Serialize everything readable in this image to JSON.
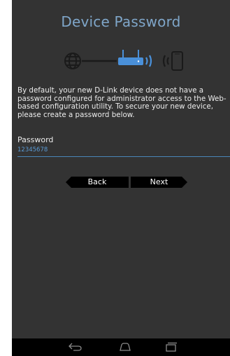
{
  "page": {
    "title": "Device Password",
    "description": "By default, your new D-Link device does not have a password configured for administrator access to the Web-based configuration utility. To secure your new device, please create a password below."
  },
  "illustration": {
    "icons": [
      "globe-icon",
      "router-icon",
      "wifi-signal-icon",
      "phone-icon"
    ],
    "colors": {
      "muted": "#1a1a1a",
      "accent": "#4a90d9"
    }
  },
  "password": {
    "label": "Password",
    "value": "12345678"
  },
  "buttons": {
    "back_label": "Back",
    "next_label": "Next"
  },
  "system_nav": {
    "icons": [
      "back-nav-icon",
      "home-nav-icon",
      "recents-nav-icon"
    ]
  },
  "colors": {
    "background": "#333333",
    "title": "#7fa6c9",
    "input_underline": "#4a86b8",
    "button": "#000000"
  }
}
